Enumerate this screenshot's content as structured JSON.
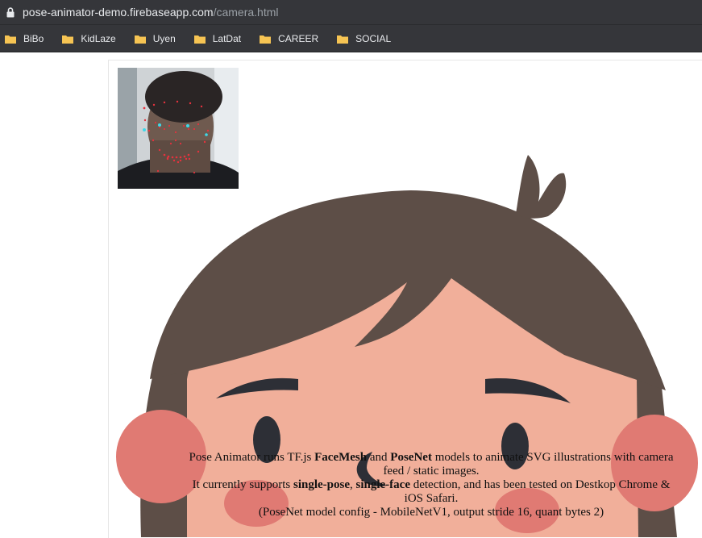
{
  "browser": {
    "url_host": "pose-animator-demo.firebaseapp.com",
    "url_path": "/camera.html",
    "bookmarks": [
      "BiBo",
      "KidLaze",
      "Uyen",
      "LatDat",
      "CAREER",
      "SOCIAL"
    ]
  },
  "description": {
    "line1_pre": "Pose Animator runs TF.js ",
    "line1_facemesh": "FaceMesh",
    "line1_and": " and ",
    "line1_posenet": "PoseNet",
    "line1_post": " models to animate SVG illustrations with camera feed / static images.",
    "line2_pre": "It currently supports ",
    "line2_single_pose": "single-pose",
    "line2_comma": ", ",
    "line2_single_face": "single-face",
    "line2_post": " detection, and has been tested on Destkop Chrome & iOS Safari.",
    "line3": "(PoseNet model config - MobileNetV1, output stride 16, quant bytes 2)"
  },
  "colors": {
    "chrome_bg": "#35363a",
    "hair": "#5d4e47",
    "skin": "#f1af9a",
    "cheek": "#e07a73",
    "feature": "#2d2f36",
    "folder": "#f6c453"
  }
}
